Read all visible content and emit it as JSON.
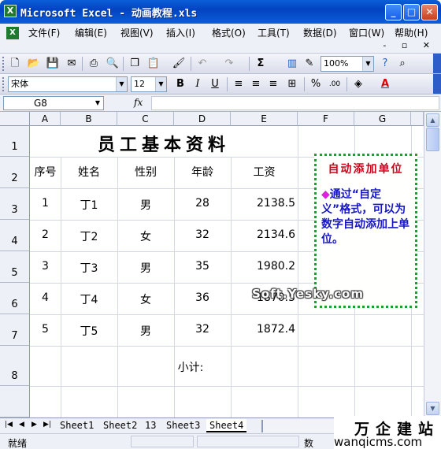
{
  "window": {
    "title": "Microsoft Excel - 动画教程.xls",
    "app_icon": "X"
  },
  "menu": [
    "文件(F)",
    "编辑(E)",
    "视图(V)",
    "插入(I)",
    "格式(O)",
    "工具(T)",
    "数据(D)",
    "窗口(W)",
    "帮助(H)"
  ],
  "toolbar": {
    "zoom": "100%",
    "font_name": "宋体",
    "font_size": "12",
    "bold": "B",
    "italic": "I",
    "underline": "U",
    "percent": "%",
    "sigma": "Σ"
  },
  "formula_bar": {
    "name_box": "G8",
    "fx": "fx",
    "content": ""
  },
  "columns": [
    "A",
    "B",
    "C",
    "D",
    "E",
    "F",
    "G"
  ],
  "rows": [
    "1",
    "2",
    "3",
    "4",
    "5",
    "6",
    "7",
    "8"
  ],
  "sheet": {
    "title": "员工基本资料",
    "headers": [
      "序号",
      "姓名",
      "性别",
      "年龄",
      "工资"
    ],
    "records": [
      [
        "1",
        "丁1",
        "男",
        "28",
        "2138.5"
      ],
      [
        "2",
        "丁2",
        "女",
        "32",
        "2134.6"
      ],
      [
        "3",
        "丁3",
        "男",
        "35",
        "1980.2"
      ],
      [
        "4",
        "丁4",
        "女",
        "36",
        "1870.5"
      ],
      [
        "5",
        "丁5",
        "男",
        "32",
        "1872.4"
      ]
    ],
    "subtotal_label": "小计:"
  },
  "note": {
    "title": "自动添加单位",
    "bullet": "◆",
    "body": "通过“自定义”格式，可以为数字自动添加上单位。"
  },
  "watermark": "Soft.Yesky.com",
  "tabs": [
    "Sheet1",
    "Sheet2",
    "13",
    "Sheet3",
    "Sheet4"
  ],
  "active_tab": "Sheet4",
  "status": {
    "text": "就绪",
    "num": "数"
  },
  "site_watermark": {
    "cn": "万企建站",
    "en": "wanqicms.com"
  }
}
